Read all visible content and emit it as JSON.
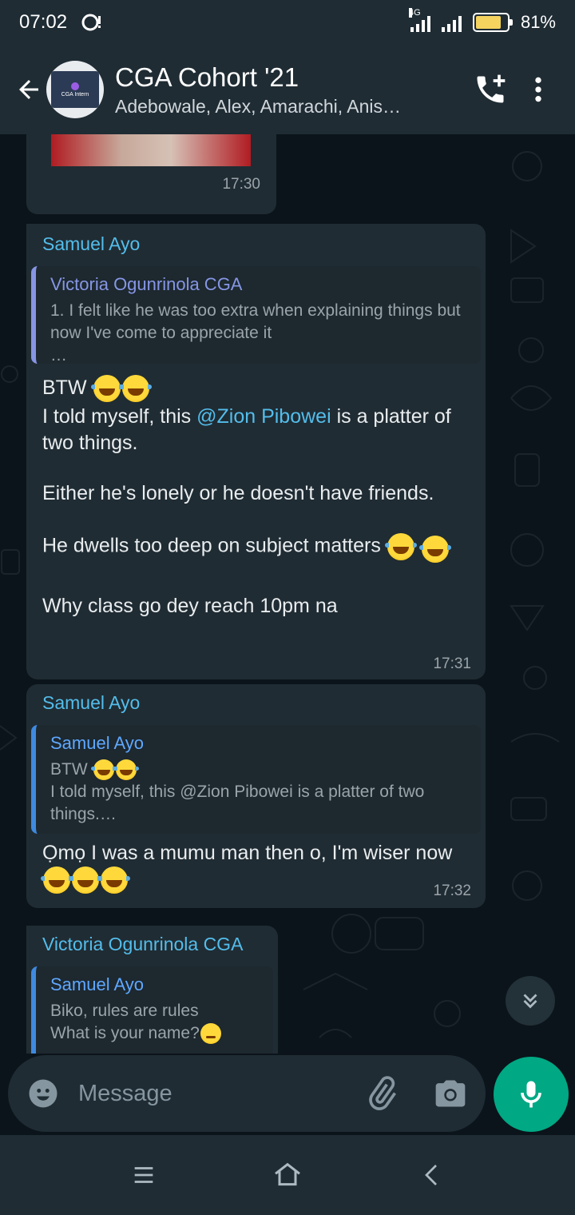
{
  "status_bar": {
    "time": "07:02",
    "network": "4G",
    "battery": "81%",
    "battery_level": 0.81
  },
  "header": {
    "title": "CGA Cohort '21",
    "subtitle": "Adebowale, Alex, Amarachi, Anis…",
    "avatar_text": "CGA Intern"
  },
  "messages": [
    {
      "time": "17:30"
    },
    {
      "sender": "Samuel Ayo",
      "quote_name": "Victoria Ogunrinola CGA",
      "quote_text": "1. I felt like he was too extra when explaining things but now I've come to appreciate it\n…",
      "line1": "BTW",
      "line2_pre": "I told myself, this ",
      "mention": "@Zion Pibowei",
      "line2_post": " is a platter of two things.",
      "line3": "Either he's lonely or he doesn't have friends.",
      "line4": "He dwells too deep on subject matters",
      "line5": "Why class go dey reach 10pm na",
      "time": "17:31"
    },
    {
      "sender": "Samuel Ayo",
      "quote_name": "Samuel Ayo",
      "quote_line1": "BTW",
      "quote_line2": "I told myself, this @Zion Pibowei is a platter of two things.…",
      "body": "Ọmọ I was a mumu man then o, I'm wiser now",
      "time": "17:32"
    },
    {
      "sender": "Victoria Ogunrinola CGA",
      "quote_name": "Samuel Ayo",
      "quote_line1": "Biko, rules are rules",
      "quote_line2": "What is your name?"
    }
  ],
  "compose": {
    "placeholder": "Message"
  },
  "colors": {
    "accent": "#00a884",
    "bubble": "#202c33",
    "mention": "#53bdeb"
  }
}
